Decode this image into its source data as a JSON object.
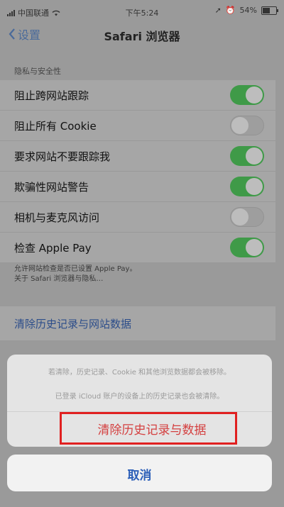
{
  "status_bar": {
    "carrier": "中国联通",
    "time": "下午5:24",
    "battery": "54%",
    "battery_level": 0.54
  },
  "nav": {
    "back_label": "设置",
    "title": "Safari 浏览器"
  },
  "privacy": {
    "header": "隐私与安全性",
    "rows": [
      {
        "label": "阻止跨网站跟踪",
        "on": true
      },
      {
        "label": "阻止所有 Cookie",
        "on": false
      },
      {
        "label": "要求网站不要跟踪我",
        "on": true
      },
      {
        "label": "欺骗性网站警告",
        "on": true
      },
      {
        "label": "相机与麦克风访问",
        "on": false
      },
      {
        "label": "检查 Apple Pay",
        "on": true
      }
    ],
    "footer_line1": "允许网站检查是否已设置 Apple Pay。",
    "footer_line2": "关于 Safari 浏览器与隐私…"
  },
  "clear": {
    "label": "清除历史记录与网站数据"
  },
  "sheet": {
    "message_line1": "若清除，历史记录、Cookie 和其他浏览数据都会被移除。",
    "message_line2": "已登录 iCloud 账户的设备上的历史记录也会被清除。",
    "destructive_label": "清除历史记录与数据",
    "cancel_label": "取消"
  },
  "colors": {
    "toggle_on": "#3f9a48",
    "destructive": "#d44040",
    "link": "#2c5fb8",
    "highlight": "#e02020"
  }
}
